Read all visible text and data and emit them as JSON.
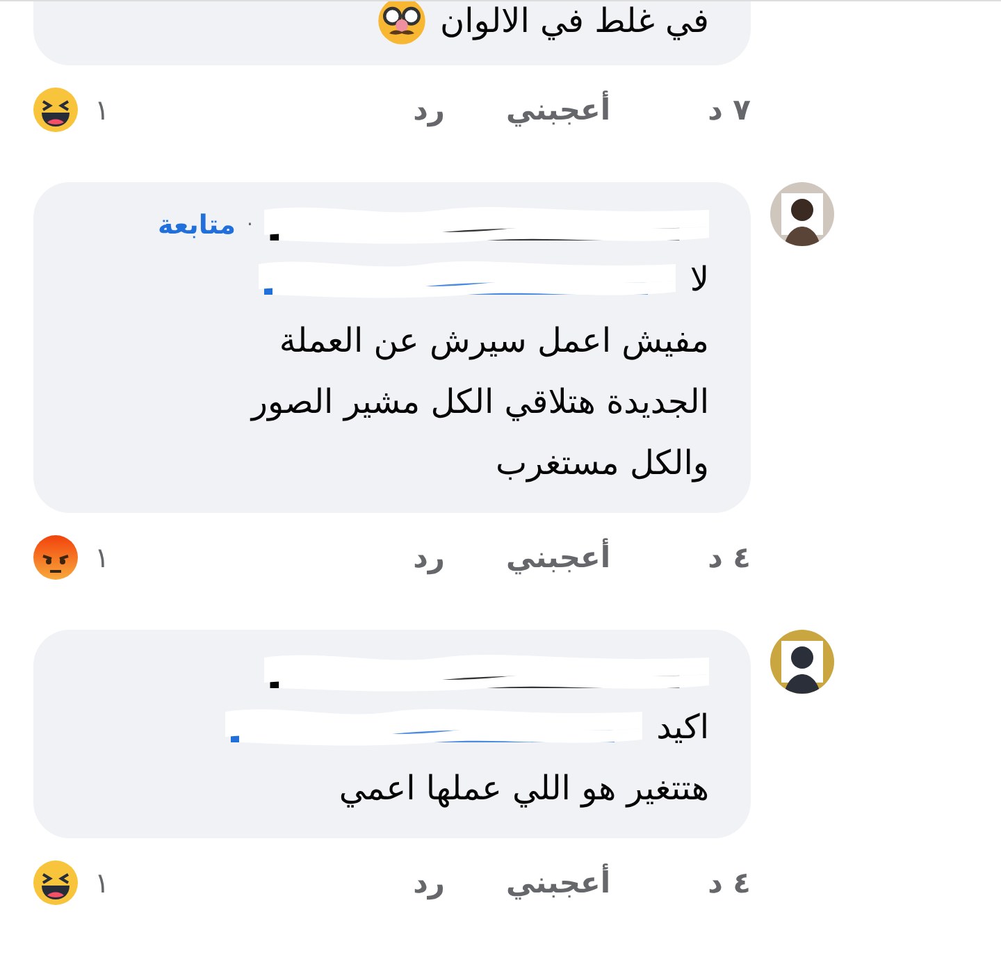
{
  "comments": [
    {
      "kind": "partial",
      "lines": [
        "في غلط في الالوان"
      ],
      "emoji": {
        "kind": "disguise"
      },
      "time": "٧ د",
      "like": "أعجبني",
      "reply": "رد",
      "reaction": {
        "kind": "haha",
        "count": "١"
      }
    },
    {
      "kind": "full",
      "header": {
        "separator": "·",
        "follow": "متابعة"
      },
      "lead": "لا",
      "lines": [
        "مفيش اعمل سيرش عن العملة",
        "الجديدة هتلاقي الكل مشير الصور",
        "والكل مستغرب"
      ],
      "time": "٤ د",
      "like": "أعجبني",
      "reply": "رد",
      "reaction": {
        "kind": "angry",
        "count": "١"
      }
    },
    {
      "kind": "full",
      "lead": "اكيد",
      "lines": [
        "هتتغير هو اللي عملها اعمي"
      ],
      "time": "٤ د",
      "like": "أعجبني",
      "reply": "رد",
      "reaction": {
        "kind": "haha",
        "count": "١"
      }
    }
  ]
}
